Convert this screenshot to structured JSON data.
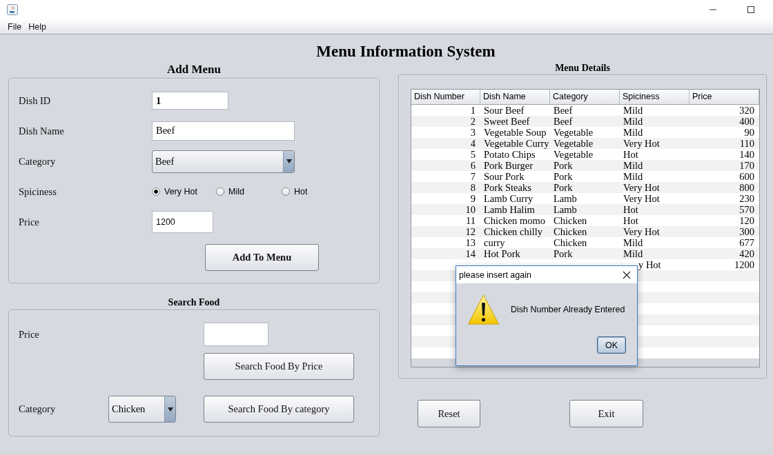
{
  "menu": [
    "File",
    "Help"
  ],
  "title": "Menu Information System",
  "add_menu": {
    "title": "Add Menu",
    "fields": [
      {
        "label": "Dish ID",
        "kind": "text",
        "value": "1",
        "bold": true
      },
      {
        "label": "Dish Name",
        "kind": "text",
        "value": "Beef",
        "bold": false
      },
      {
        "label": "Category",
        "kind": "select",
        "value": "Beef"
      },
      {
        "label": "Spiciness",
        "kind": "radio",
        "options": [
          {
            "label": "Very Hot",
            "selected": true
          },
          {
            "label": "Mild",
            "selected": false
          },
          {
            "label": "Hot",
            "selected": false
          }
        ]
      },
      {
        "label": "Price",
        "kind": "number",
        "value": "1200"
      }
    ],
    "button": "Add To Menu"
  },
  "search_food": {
    "title": "Search Food",
    "price_label": "Price",
    "price_button": "Search Food By Price",
    "category_label": "Category",
    "category_value": "Chicken",
    "category_button": "Search Food By category"
  },
  "menu_details": {
    "title": "Menu Details",
    "columns": [
      "Dish Number",
      "Dish Name",
      "Category",
      "Spiciness",
      "Price"
    ],
    "rows": [
      {
        "cells": [
          "1",
          "Sour Beef",
          "Beef",
          "Mild",
          "320"
        ],
        "covered": false
      },
      {
        "cells": [
          "2",
          "Sweet Beef",
          "Beef",
          "Mild",
          "400"
        ],
        "covered": false
      },
      {
        "cells": [
          "3",
          "Vegetable Soup",
          "Vegetable",
          "Mild",
          "90"
        ],
        "covered": false
      },
      {
        "cells": [
          "4",
          "Vegetable Curry",
          "Vegetable",
          "Very Hot",
          "110"
        ],
        "covered": false
      },
      {
        "cells": [
          "5",
          "Potato Chips",
          "Vegetable",
          "Hot",
          "140"
        ],
        "covered": false
      },
      {
        "cells": [
          "6",
          "Pork Burger",
          "Pork",
          "Mild",
          "170"
        ],
        "covered": false
      },
      {
        "cells": [
          "7",
          "Sour Pork",
          "Pork",
          "Mild",
          "600"
        ],
        "covered": false
      },
      {
        "cells": [
          "8",
          "Pork Steaks",
          "Pork",
          "Very Hot",
          "800"
        ],
        "covered": false
      },
      {
        "cells": [
          "9",
          "Lamb Curry",
          "Lamb",
          "Very Hot",
          "230"
        ],
        "covered": false
      },
      {
        "cells": [
          "10",
          "Lamb Halim",
          "Lamb",
          "Hot",
          "570"
        ],
        "covered": false
      },
      {
        "cells": [
          "11",
          "Chicken momo",
          "Chicken",
          "Hot",
          "120"
        ],
        "covered": false
      },
      {
        "cells": [
          "12",
          "Chicken chilly",
          "Chicken",
          "Very Hot",
          "300"
        ],
        "covered": false
      },
      {
        "cells": [
          "13",
          "curry",
          "Chicken",
          "Mild",
          "677"
        ],
        "covered": false
      },
      {
        "cells": [
          "14",
          "Hot Pork",
          "Pork",
          "Mild",
          "420"
        ],
        "covered": false
      },
      {
        "cells": [
          "",
          "",
          "",
          "y Hot",
          "1200"
        ],
        "covered": true
      }
    ]
  },
  "buttons": [
    "Reset",
    "Exit"
  ],
  "dialog": {
    "title": "please insert again",
    "message": "Dish Number Already Entered",
    "button": "OK"
  }
}
